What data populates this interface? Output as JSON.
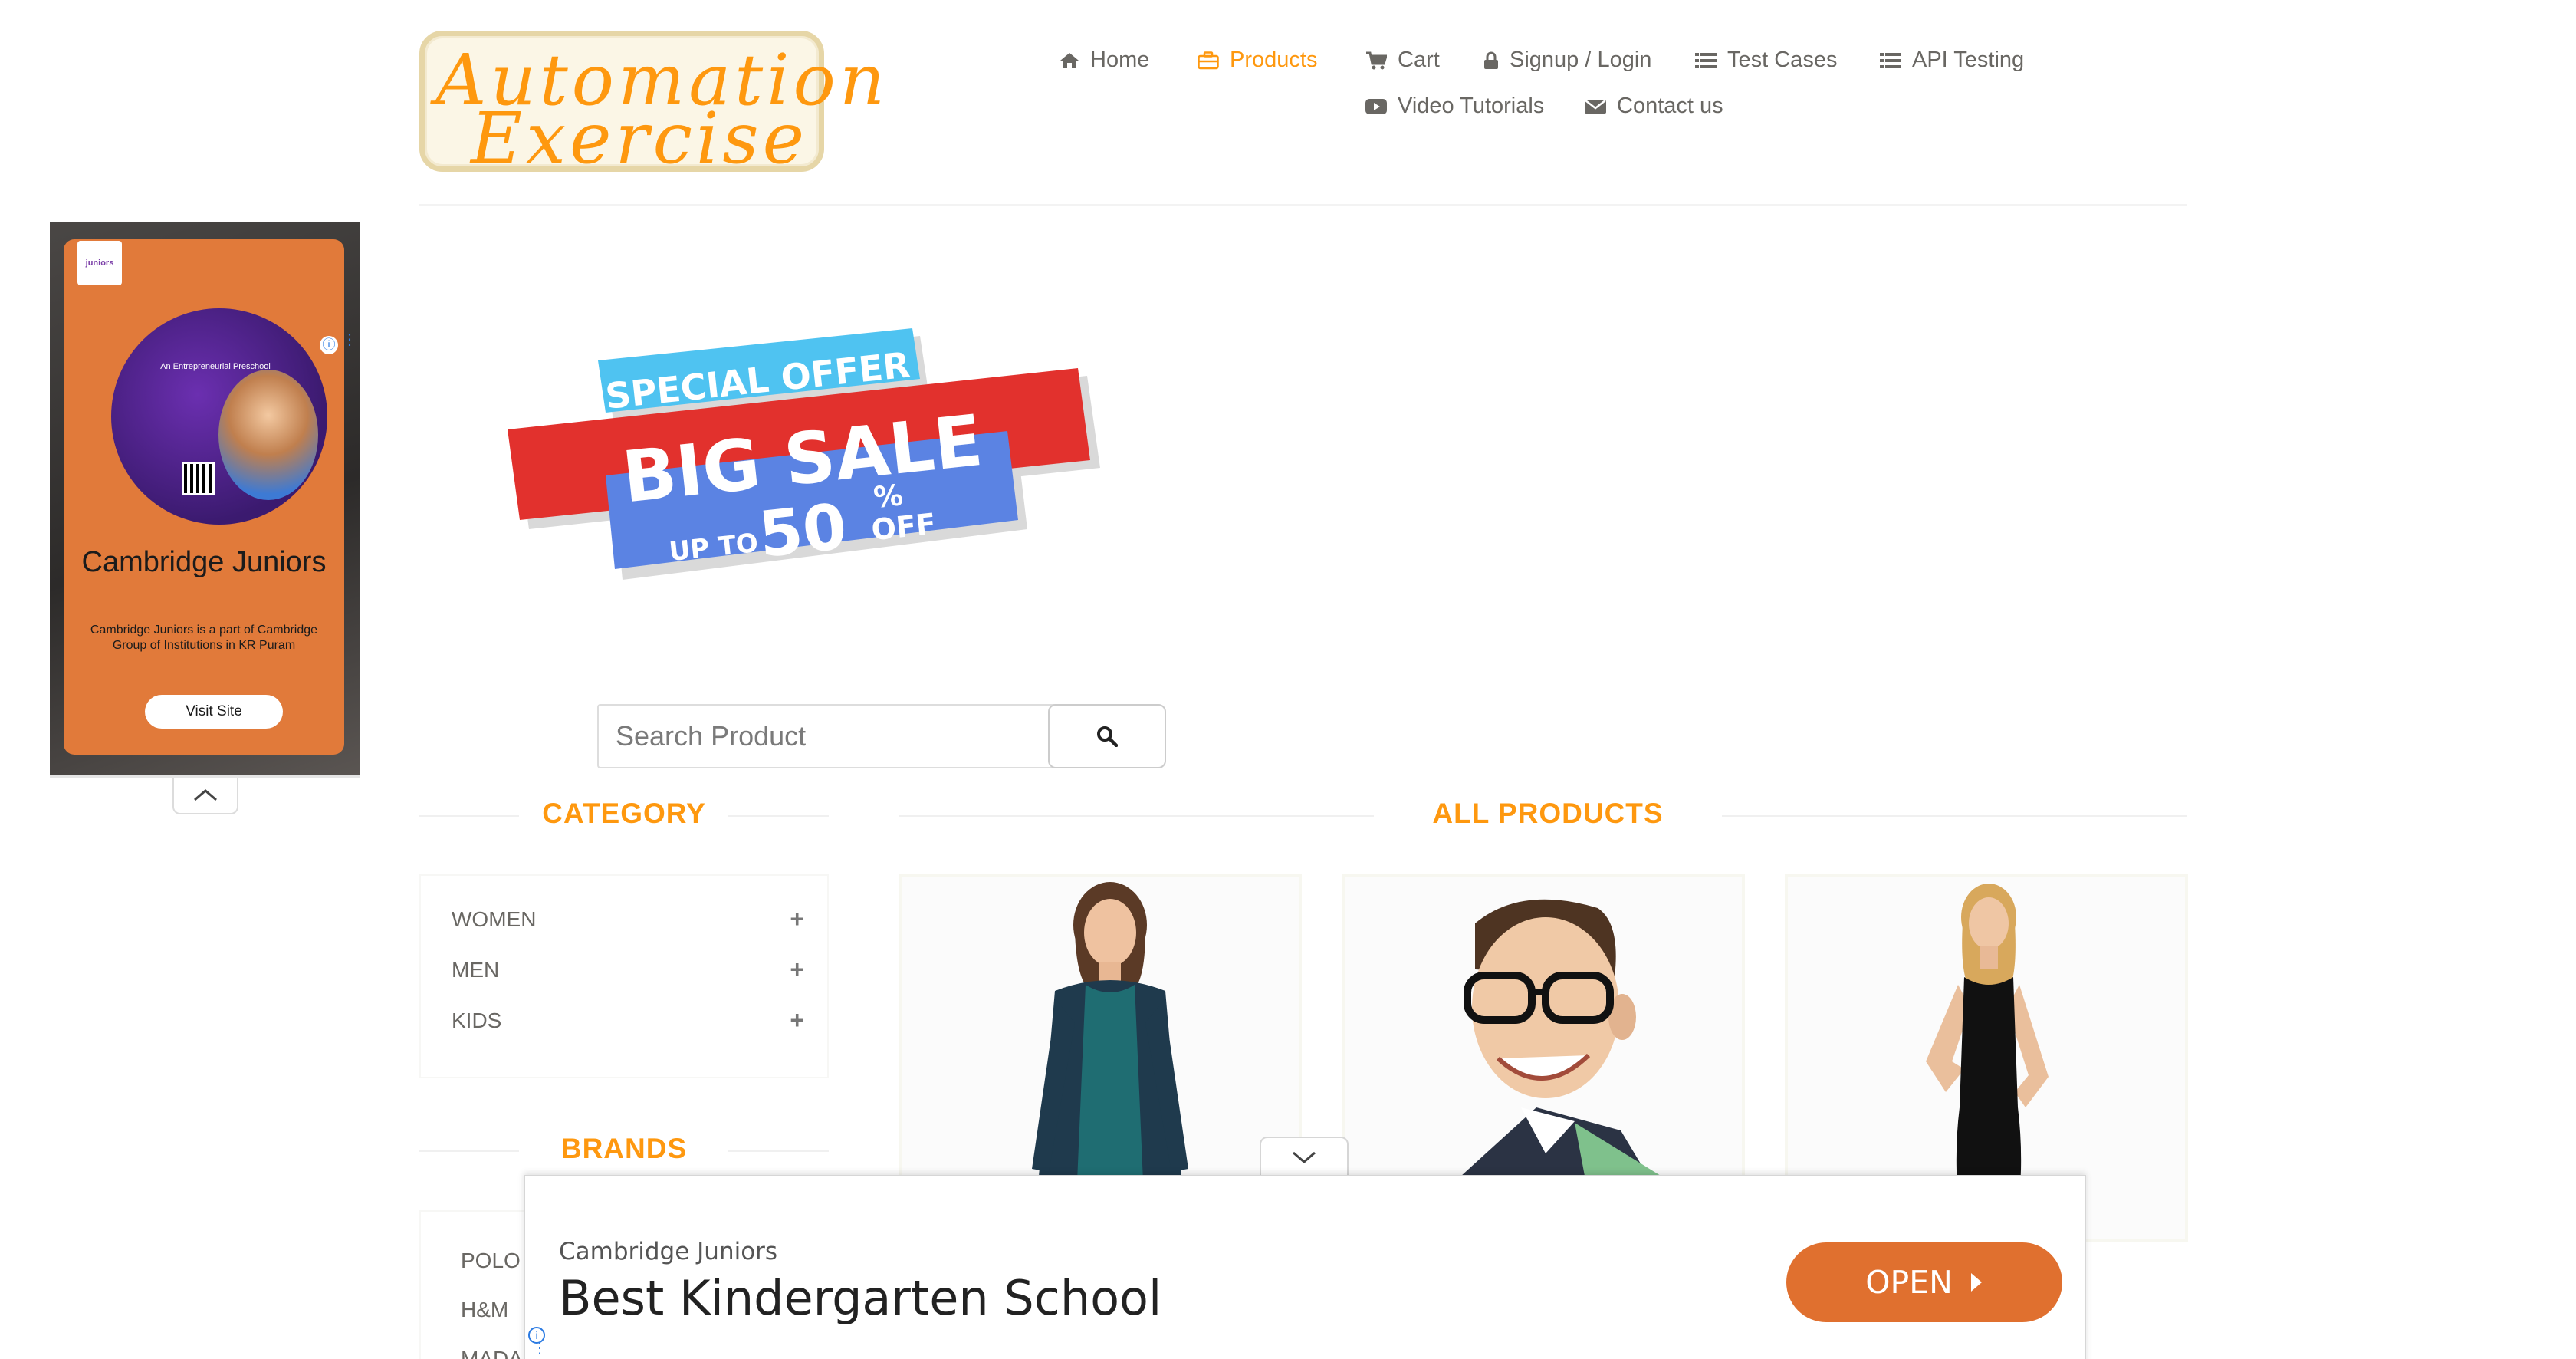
{
  "logo": {
    "line1": "Automation",
    "line2": "Exercise"
  },
  "nav": {
    "items": [
      {
        "label": "Home",
        "icon": "home-icon"
      },
      {
        "label": "Products",
        "icon": "briefcase-icon",
        "active": true
      },
      {
        "label": "Cart",
        "icon": "cart-icon"
      },
      {
        "label": "Signup / Login",
        "icon": "lock-icon"
      },
      {
        "label": "Test Cases",
        "icon": "list-icon"
      },
      {
        "label": "API Testing",
        "icon": "list-icon"
      },
      {
        "label": "Video Tutorials",
        "icon": "youtube-play-icon"
      },
      {
        "label": "Contact us",
        "icon": "envelope-icon"
      }
    ]
  },
  "left_ad": {
    "badge": "juniors",
    "poster_title": "An Entrepreneurial Preschool",
    "title": "Cambridge Juniors",
    "description": "Cambridge Juniors is a part of Cambridge Group of Institutions in KR Puram",
    "cta": "Visit Site"
  },
  "banner": {
    "line1": "SPECIAL OFFER",
    "line2": "BIG SALE",
    "line3_prefix": "UP TO",
    "line3_value": "50",
    "line3_suffix_top": "%",
    "line3_suffix": "OFF"
  },
  "search": {
    "placeholder": "Search Product",
    "value": ""
  },
  "category": {
    "title": "CATEGORY",
    "items": [
      {
        "label": "WOMEN"
      },
      {
        "label": "MEN"
      },
      {
        "label": "KIDS"
      }
    ],
    "expand_symbol": "+"
  },
  "brands": {
    "title": "BRANDS",
    "items": [
      {
        "label": "POLO"
      },
      {
        "label": "H&M"
      },
      {
        "label": "MADA"
      }
    ]
  },
  "products": {
    "title": "ALL PRODUCTS"
  },
  "bottom_ad": {
    "advertiser": "Cambridge Juniors",
    "headline": "Best Kindergarten School",
    "cta": "OPEN"
  },
  "colors": {
    "accent": "#fe980f",
    "text": "#696763",
    "ad_orange": "#e0702f",
    "ad_info": "#2a7ae2"
  }
}
